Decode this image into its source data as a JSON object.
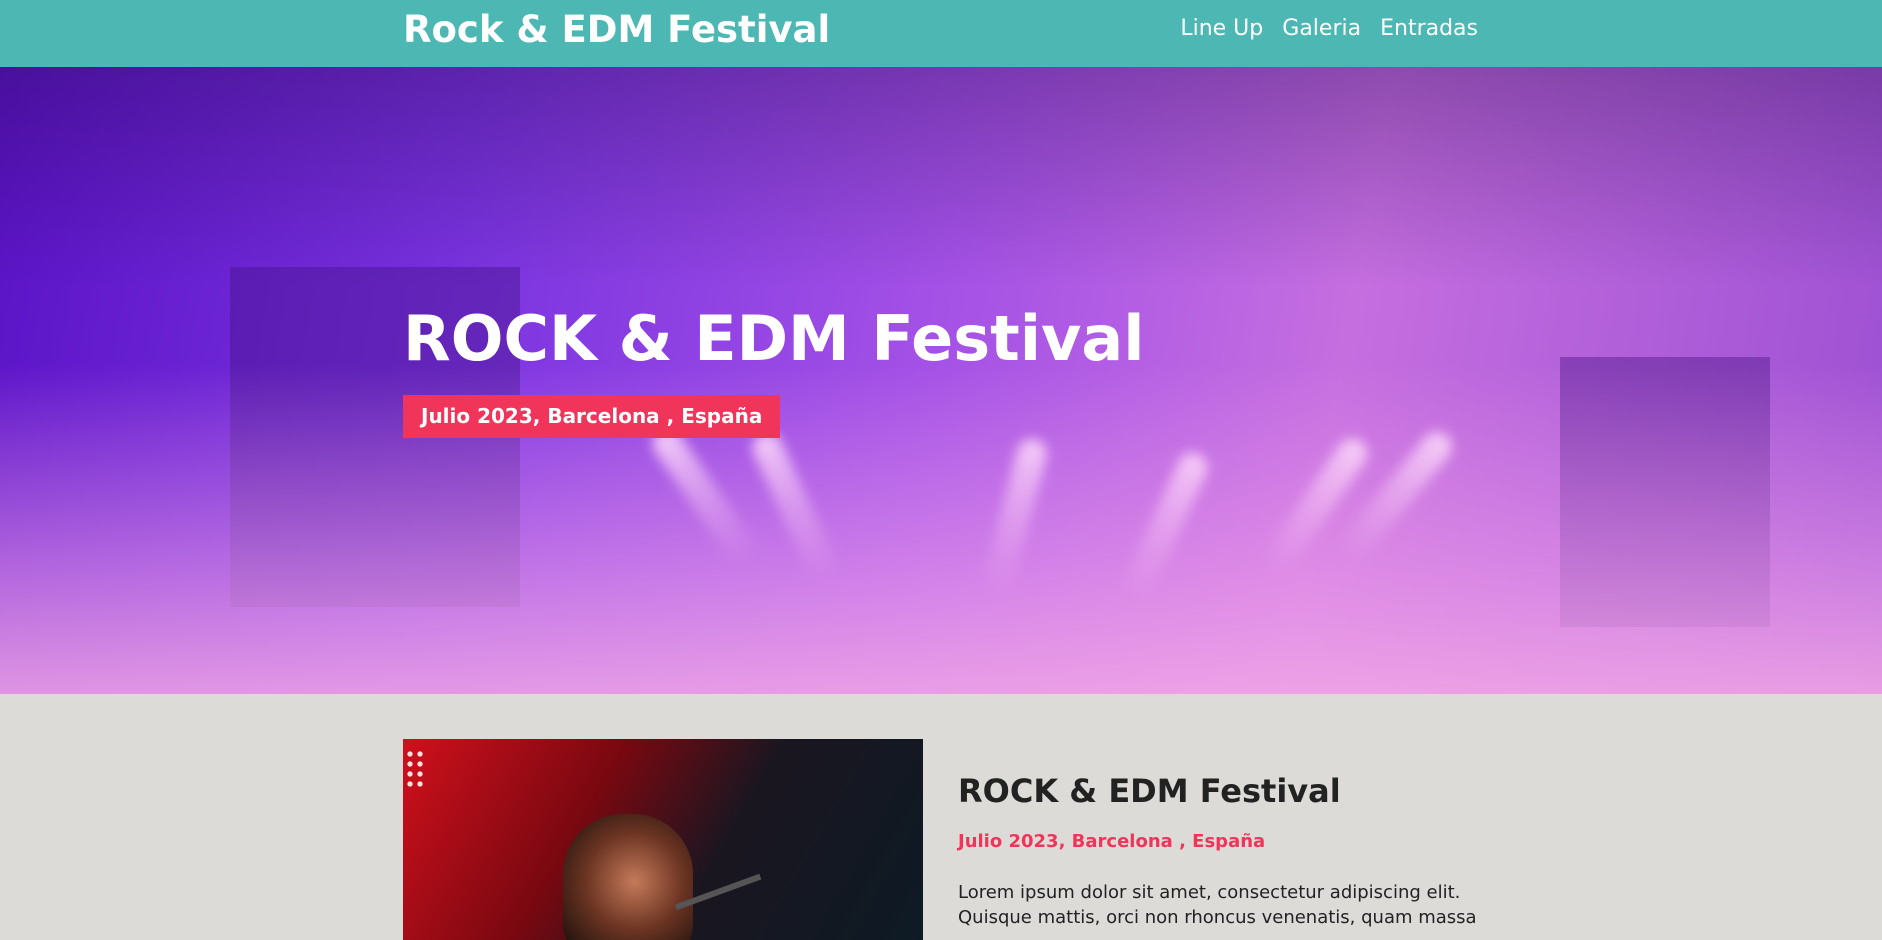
{
  "header": {
    "logo": "Rock & EDM Festival",
    "nav": [
      {
        "label": "Line Up"
      },
      {
        "label": "Galeria"
      },
      {
        "label": "Entradas"
      }
    ]
  },
  "hero": {
    "title": "ROCK & EDM Festival",
    "badge": "Julio 2023, Barcelona , España"
  },
  "about": {
    "title": "ROCK & EDM Festival",
    "date": "Julio 2023, Barcelona , España",
    "text": "Lorem ipsum dolor sit amet, consectetur adipiscing elit. Quisque mattis, orci non rhoncus venenatis, quam massa"
  },
  "colors": {
    "header_bg": "#4db8b3",
    "accent": "#f0345a",
    "page_bg": "#dcdbd7"
  }
}
